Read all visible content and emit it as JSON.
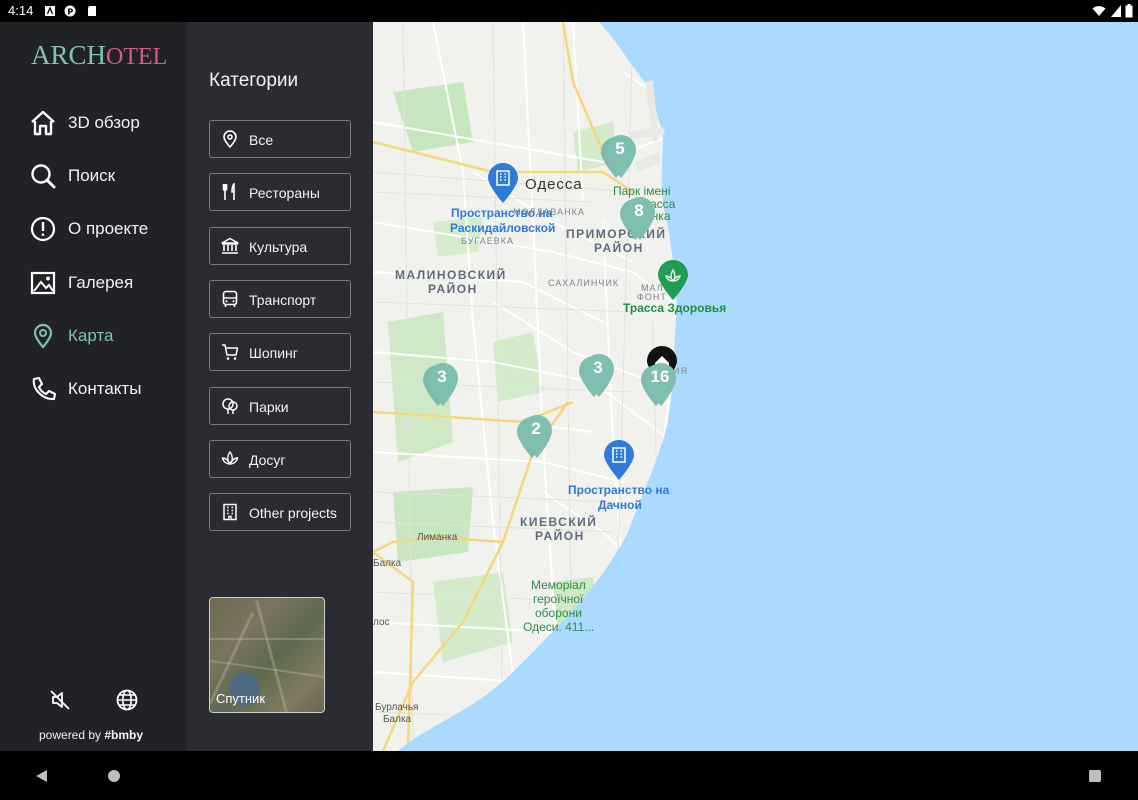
{
  "status_bar": {
    "time": "4:14"
  },
  "app": {
    "logo_part1": "ARCH",
    "logo_part2": "OTEL"
  },
  "menu": {
    "items": [
      {
        "label": "3D обзор",
        "icon": "home-icon"
      },
      {
        "label": "Поиск",
        "icon": "search-icon"
      },
      {
        "label": "О проекте",
        "icon": "info-icon"
      },
      {
        "label": "Галерея",
        "icon": "image-icon"
      },
      {
        "label": "Карта",
        "icon": "map-pin-icon",
        "active": true
      },
      {
        "label": "Контакты",
        "icon": "phone-icon"
      }
    ],
    "powered_prefix": "powered by ",
    "powered_brand": "#bmby"
  },
  "categories": {
    "title": "Категории",
    "items": [
      {
        "label": "Все",
        "icon": "pin-icon"
      },
      {
        "label": "Рестораны",
        "icon": "fork-knife-icon"
      },
      {
        "label": "Культура",
        "icon": "museum-icon"
      },
      {
        "label": "Транспорт",
        "icon": "bus-icon"
      },
      {
        "label": "Шопинг",
        "icon": "cart-icon"
      },
      {
        "label": "Парки",
        "icon": "tree-icon"
      },
      {
        "label": "Досуг",
        "icon": "lotus-icon"
      },
      {
        "label": "Other projects",
        "icon": "building-icon"
      }
    ],
    "satellite_label": "Спутник"
  },
  "map": {
    "labels": {
      "odessa": "Одесса",
      "park_1": "Парк імені",
      "park_2": "асса",
      "park_3": "енка",
      "moldavanka": "МОЛДАВАНКА",
      "bugaevka": "БУГАЕВКА",
      "primorsky_1": "ПРИМОРСКИЙ",
      "primorsky_2": "РАЙОН",
      "malinovsky_1": "МАЛИНОВСКИЙ",
      "malinovsky_2": "РАЙОН",
      "sakhalinchik": "САХАЛИНЧИК",
      "mal_1": "МАЛ",
      "mal_2": "ФОНТ",
      "poi_raskidailovskaya_1": "Пространство на",
      "poi_raskidailovskaya_2": "Раскидайловской",
      "poi_trassa": "Трасса Здоровья",
      "poi_dachnaya_1": "Пространство на",
      "poi_dachnaya_2": "Дачной",
      "kievsky_1": "КИЕВСКИЙ",
      "kievsky_2": "РАЙОН",
      "limanka": "Лиманка",
      "memorial_1": "Меморіал",
      "memorial_2": "героїчної",
      "memorial_3": "оборони",
      "memorial_4": "Одеси. 411...",
      "balka": "Балка",
      "los": "лос",
      "burlachya_1": "Бурлачья",
      "burlachya_2": "Балка",
      "iya": "ИЯ"
    },
    "clusters": [
      {
        "count": "5"
      },
      {
        "count": "8"
      },
      {
        "count": "3"
      },
      {
        "count": "3"
      },
      {
        "count": "16"
      },
      {
        "count": "2"
      }
    ],
    "colors": {
      "water": "#aadaff",
      "cluster": "#7fbfb0",
      "poi_blue": "#2f7bd6",
      "poi_green": "#1f9d55",
      "accent": "#7fc2b4"
    }
  }
}
